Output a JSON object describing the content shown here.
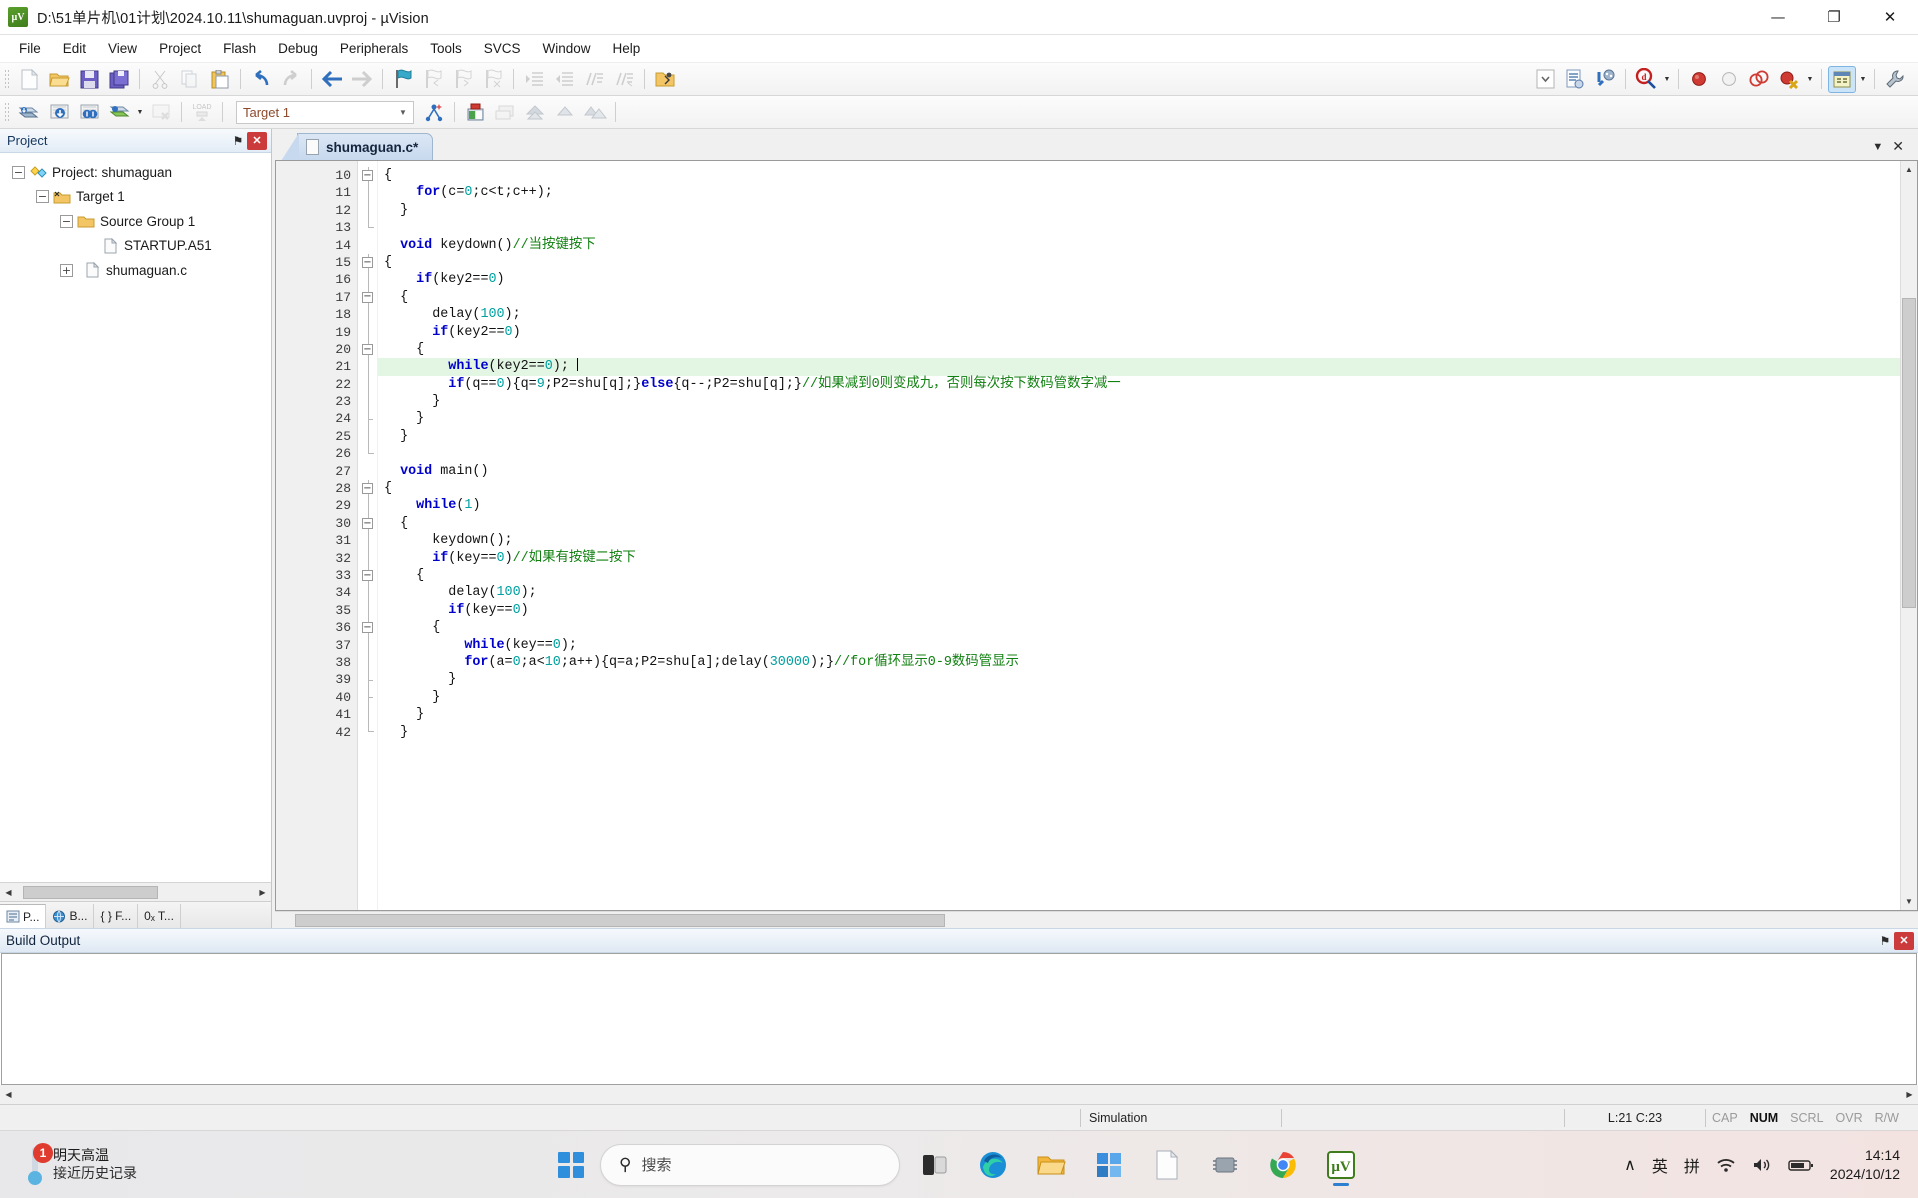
{
  "window": {
    "title": "D:\\51单片机\\01计划\\2024.10.11\\shumaguan.uvproj - µVision",
    "app_icon_text": "µV",
    "minimize": "—",
    "maximize": "❐",
    "close": "✕"
  },
  "menubar": {
    "items": [
      "File",
      "Edit",
      "View",
      "Project",
      "Flash",
      "Debug",
      "Peripherals",
      "Tools",
      "SVCS",
      "Window",
      "Help"
    ]
  },
  "toolbar_main": {
    "target_value": "Target 1",
    "buttons": [
      {
        "name": "new-file-icon"
      },
      {
        "name": "open-file-icon"
      },
      {
        "name": "save-icon"
      },
      {
        "name": "save-all-icon"
      },
      {
        "name": "cut-icon"
      },
      {
        "name": "copy-icon"
      },
      {
        "name": "paste-icon"
      },
      {
        "name": "undo-icon"
      },
      {
        "name": "redo-icon"
      },
      {
        "name": "navigate-back-icon"
      },
      {
        "name": "navigate-forward-icon"
      },
      {
        "name": "bookmark-toggle-icon"
      },
      {
        "name": "bookmark-prev-icon"
      },
      {
        "name": "bookmark-next-icon"
      },
      {
        "name": "bookmark-clear-icon"
      },
      {
        "name": "indent-icon"
      },
      {
        "name": "outdent-icon"
      },
      {
        "name": "comment-icon"
      },
      {
        "name": "uncomment-icon"
      },
      {
        "name": "open-folder-icon"
      },
      {
        "name": "insert-dropdown-icon"
      },
      {
        "name": "configure-icon"
      },
      {
        "name": "debug-settings-icon"
      },
      {
        "name": "start-debug-icon"
      },
      {
        "name": "insert-breakpoint-icon"
      },
      {
        "name": "disable-breakpoint-icon"
      },
      {
        "name": "kill-all-breakpoints-icon"
      },
      {
        "name": "disable-all-breakpoints-icon"
      },
      {
        "name": "window-layout-icon"
      },
      {
        "name": "configure-target-icon"
      }
    ]
  },
  "toolbar_build": {
    "buttons": [
      {
        "name": "translate-icon"
      },
      {
        "name": "build-icon"
      },
      {
        "name": "rebuild-icon"
      },
      {
        "name": "batch-build-icon"
      },
      {
        "name": "stop-build-icon"
      },
      {
        "name": "download-icon"
      },
      {
        "name": "target-options-icon"
      },
      {
        "name": "manage-components-icon"
      },
      {
        "name": "pack-installer-icon"
      },
      {
        "name": "manage-project-icon"
      },
      {
        "name": "svcs-up-icon"
      },
      {
        "name": "svcs-layers-icon"
      }
    ]
  },
  "project_panel": {
    "title": "Project",
    "pin_glyph": "⚑",
    "close_glyph": "✕",
    "tree": [
      {
        "label": "Project: shumaguan",
        "icon": "project-icon",
        "expander": "−",
        "depth": 0
      },
      {
        "label": "Target 1",
        "icon": "target-folder-icon",
        "expander": "−",
        "depth": 1
      },
      {
        "label": "Source Group 1",
        "icon": "folder-icon",
        "expander": "−",
        "depth": 2
      },
      {
        "label": "STARTUP.A51",
        "icon": "file-icon",
        "expander": "",
        "depth": 3
      },
      {
        "label": "shumaguan.c",
        "icon": "file-icon",
        "expander": "+",
        "depth": 3
      }
    ],
    "bottom_tabs": [
      {
        "label": "P...",
        "icon": "project-tab-icon",
        "selected": true
      },
      {
        "label": "B...",
        "icon": "books-tab-icon",
        "selected": false
      },
      {
        "label": "{ } F...",
        "icon": "functions-tab-icon",
        "selected": false
      },
      {
        "label": "0ₓ T...",
        "icon": "templates-tab-icon",
        "selected": false
      }
    ]
  },
  "editor": {
    "tab_label": "shumaguan.c*",
    "tabstrip_right": {
      "dropdown": "▼",
      "close": "✕"
    },
    "first_line_number": 10,
    "cursor_line": 21,
    "lines": [
      {
        "n": 10,
        "fold": "box-minus",
        "tokens": [
          {
            "t": "{",
            "c": "plain"
          }
        ]
      },
      {
        "n": 11,
        "fold": "bar",
        "tokens": [
          {
            "t": "    ",
            "c": "plain"
          },
          {
            "t": "for",
            "c": "kw"
          },
          {
            "t": "(c=",
            "c": "plain"
          },
          {
            "t": "0",
            "c": "num"
          },
          {
            "t": ";c<t;c++);",
            "c": "plain"
          }
        ]
      },
      {
        "n": 12,
        "fold": "bar",
        "tokens": [
          {
            "t": "  }",
            "c": "plain"
          }
        ]
      },
      {
        "n": 13,
        "fold": "end",
        "tokens": [
          {
            "t": "",
            "c": "plain"
          }
        ]
      },
      {
        "n": 14,
        "fold": "none",
        "tokens": [
          {
            "t": "  ",
            "c": "plain"
          },
          {
            "t": "void",
            "c": "kw"
          },
          {
            "t": " keydown()",
            "c": "plain"
          },
          {
            "t": "//当按键按下",
            "c": "cmt"
          }
        ]
      },
      {
        "n": 15,
        "fold": "box-minus",
        "tokens": [
          {
            "t": "{",
            "c": "plain"
          }
        ]
      },
      {
        "n": 16,
        "fold": "bar",
        "tokens": [
          {
            "t": "    ",
            "c": "plain"
          },
          {
            "t": "if",
            "c": "kw"
          },
          {
            "t": "(key2==",
            "c": "plain"
          },
          {
            "t": "0",
            "c": "num"
          },
          {
            "t": ")",
            "c": "plain"
          }
        ]
      },
      {
        "n": 17,
        "fold": "box-minus",
        "tokens": [
          {
            "t": "  {",
            "c": "plain"
          }
        ]
      },
      {
        "n": 18,
        "fold": "bar",
        "tokens": [
          {
            "t": "      delay(",
            "c": "plain"
          },
          {
            "t": "100",
            "c": "num"
          },
          {
            "t": ");",
            "c": "plain"
          }
        ]
      },
      {
        "n": 19,
        "fold": "bar",
        "tokens": [
          {
            "t": "      ",
            "c": "plain"
          },
          {
            "t": "if",
            "c": "kw"
          },
          {
            "t": "(key2==",
            "c": "plain"
          },
          {
            "t": "0",
            "c": "num"
          },
          {
            "t": ")",
            "c": "plain"
          }
        ]
      },
      {
        "n": 20,
        "fold": "box-minus",
        "tokens": [
          {
            "t": "    {",
            "c": "plain"
          }
        ]
      },
      {
        "n": 21,
        "fold": "bar",
        "highlight": true,
        "caret_after": true,
        "tokens": [
          {
            "t": "        ",
            "c": "plain"
          },
          {
            "t": "while",
            "c": "kw"
          },
          {
            "t": "(key2==",
            "c": "plain"
          },
          {
            "t": "0",
            "c": "num"
          },
          {
            "t": "); ",
            "c": "plain"
          }
        ]
      },
      {
        "n": 22,
        "fold": "bar",
        "tokens": [
          {
            "t": "        ",
            "c": "plain"
          },
          {
            "t": "if",
            "c": "kw"
          },
          {
            "t": "(q==",
            "c": "plain"
          },
          {
            "t": "0",
            "c": "num"
          },
          {
            "t": "){q=",
            "c": "plain"
          },
          {
            "t": "9",
            "c": "num"
          },
          {
            "t": ";P2=shu[q];}",
            "c": "plain"
          },
          {
            "t": "else",
            "c": "kw"
          },
          {
            "t": "{q--;P2=shu[q];}",
            "c": "plain"
          },
          {
            "t": "//如果减到0则变成九，否则每次按下数码管数字减一",
            "c": "cmt"
          }
        ]
      },
      {
        "n": 23,
        "fold": "bar",
        "tokens": [
          {
            "t": "      }",
            "c": "plain"
          }
        ]
      },
      {
        "n": 24,
        "fold": "dash",
        "tokens": [
          {
            "t": "    }",
            "c": "plain"
          }
        ]
      },
      {
        "n": 25,
        "fold": "bar",
        "tokens": [
          {
            "t": "  }",
            "c": "plain"
          }
        ]
      },
      {
        "n": 26,
        "fold": "end",
        "tokens": [
          {
            "t": "",
            "c": "plain"
          }
        ]
      },
      {
        "n": 27,
        "fold": "none",
        "tokens": [
          {
            "t": "  ",
            "c": "plain"
          },
          {
            "t": "void",
            "c": "kw"
          },
          {
            "t": " main()",
            "c": "plain"
          }
        ]
      },
      {
        "n": 28,
        "fold": "box-minus",
        "tokens": [
          {
            "t": "{",
            "c": "plain"
          }
        ]
      },
      {
        "n": 29,
        "fold": "bar",
        "tokens": [
          {
            "t": "    ",
            "c": "plain"
          },
          {
            "t": "while",
            "c": "kw"
          },
          {
            "t": "(",
            "c": "plain"
          },
          {
            "t": "1",
            "c": "num"
          },
          {
            "t": ")",
            "c": "plain"
          }
        ]
      },
      {
        "n": 30,
        "fold": "box-minus",
        "tokens": [
          {
            "t": "  {",
            "c": "plain"
          }
        ]
      },
      {
        "n": 31,
        "fold": "bar",
        "tokens": [
          {
            "t": "      keydown();",
            "c": "plain"
          }
        ]
      },
      {
        "n": 32,
        "fold": "bar",
        "tokens": [
          {
            "t": "      ",
            "c": "plain"
          },
          {
            "t": "if",
            "c": "kw"
          },
          {
            "t": "(key==",
            "c": "plain"
          },
          {
            "t": "0",
            "c": "num"
          },
          {
            "t": ")",
            "c": "plain"
          },
          {
            "t": "//如果有按键二按下",
            "c": "cmt"
          }
        ]
      },
      {
        "n": 33,
        "fold": "box-minus",
        "tokens": [
          {
            "t": "    {",
            "c": "plain"
          }
        ]
      },
      {
        "n": 34,
        "fold": "bar",
        "tokens": [
          {
            "t": "        delay(",
            "c": "plain"
          },
          {
            "t": "100",
            "c": "num"
          },
          {
            "t": ");",
            "c": "plain"
          }
        ]
      },
      {
        "n": 35,
        "fold": "bar",
        "tokens": [
          {
            "t": "        ",
            "c": "plain"
          },
          {
            "t": "if",
            "c": "kw"
          },
          {
            "t": "(key==",
            "c": "plain"
          },
          {
            "t": "0",
            "c": "num"
          },
          {
            "t": ")",
            "c": "plain"
          }
        ]
      },
      {
        "n": 36,
        "fold": "box-minus",
        "tokens": [
          {
            "t": "      {",
            "c": "plain"
          }
        ]
      },
      {
        "n": 37,
        "fold": "bar",
        "tokens": [
          {
            "t": "          ",
            "c": "plain"
          },
          {
            "t": "while",
            "c": "kw"
          },
          {
            "t": "(key==",
            "c": "plain"
          },
          {
            "t": "0",
            "c": "num"
          },
          {
            "t": ");",
            "c": "plain"
          }
        ]
      },
      {
        "n": 38,
        "fold": "bar",
        "tokens": [
          {
            "t": "          ",
            "c": "plain"
          },
          {
            "t": "for",
            "c": "kw"
          },
          {
            "t": "(a=",
            "c": "plain"
          },
          {
            "t": "0",
            "c": "num"
          },
          {
            "t": ";a<",
            "c": "plain"
          },
          {
            "t": "10",
            "c": "num"
          },
          {
            "t": ";a++){q=a;P2=shu[a];delay(",
            "c": "plain"
          },
          {
            "t": "30000",
            "c": "num"
          },
          {
            "t": ");}",
            "c": "plain"
          },
          {
            "t": "//for循环显示0-9数码管显示",
            "c": "cmt"
          }
        ]
      },
      {
        "n": 39,
        "fold": "dash",
        "tokens": [
          {
            "t": "        }",
            "c": "plain"
          }
        ]
      },
      {
        "n": 40,
        "fold": "dash",
        "tokens": [
          {
            "t": "      }",
            "c": "plain"
          }
        ]
      },
      {
        "n": 41,
        "fold": "bar",
        "tokens": [
          {
            "t": "    }",
            "c": "plain"
          }
        ]
      },
      {
        "n": 42,
        "fold": "end",
        "tokens": [
          {
            "t": "  }",
            "c": "plain"
          }
        ]
      }
    ]
  },
  "build_output": {
    "title": "Build Output",
    "pin_glyph": "⚑",
    "close_glyph": "✕",
    "content": ""
  },
  "statusbar": {
    "mode": "Simulation",
    "position": "L:21 C:23",
    "flags": [
      {
        "label": "CAP",
        "on": false
      },
      {
        "label": "NUM",
        "on": true
      },
      {
        "label": "SCRL",
        "on": false
      },
      {
        "label": "OVR",
        "on": false
      },
      {
        "label": "R/W",
        "on": false
      }
    ]
  },
  "taskbar": {
    "weather_line1": "明天高温",
    "weather_line2": "接近历史记录",
    "weather_badge": "1",
    "search_placeholder": "搜索",
    "search_icon": "search-icon",
    "apps": [
      {
        "name": "task-view-icon"
      },
      {
        "name": "edge-browser-icon"
      },
      {
        "name": "file-explorer-icon"
      },
      {
        "name": "microsoft-store-icon"
      },
      {
        "name": "notepad-icon"
      },
      {
        "name": "chip-app-icon"
      },
      {
        "name": "chrome-browser-icon"
      },
      {
        "name": "keil-uvision-icon"
      }
    ],
    "chevron": "∧",
    "ime_lang": "英",
    "ime_mode": "拼",
    "wifi_icon": "wifi-icon",
    "volume_icon": "volume-icon",
    "battery_icon": "battery-icon",
    "time": "14:14",
    "date": "2024/10/12"
  },
  "colors": {
    "keyword": "#0000cc",
    "comment": "#108010",
    "number": "#00a0a0",
    "highlight_line": "#e3f6e3",
    "panel_header": "#e2ecf6",
    "accent_blue": "#2f7fd0"
  }
}
